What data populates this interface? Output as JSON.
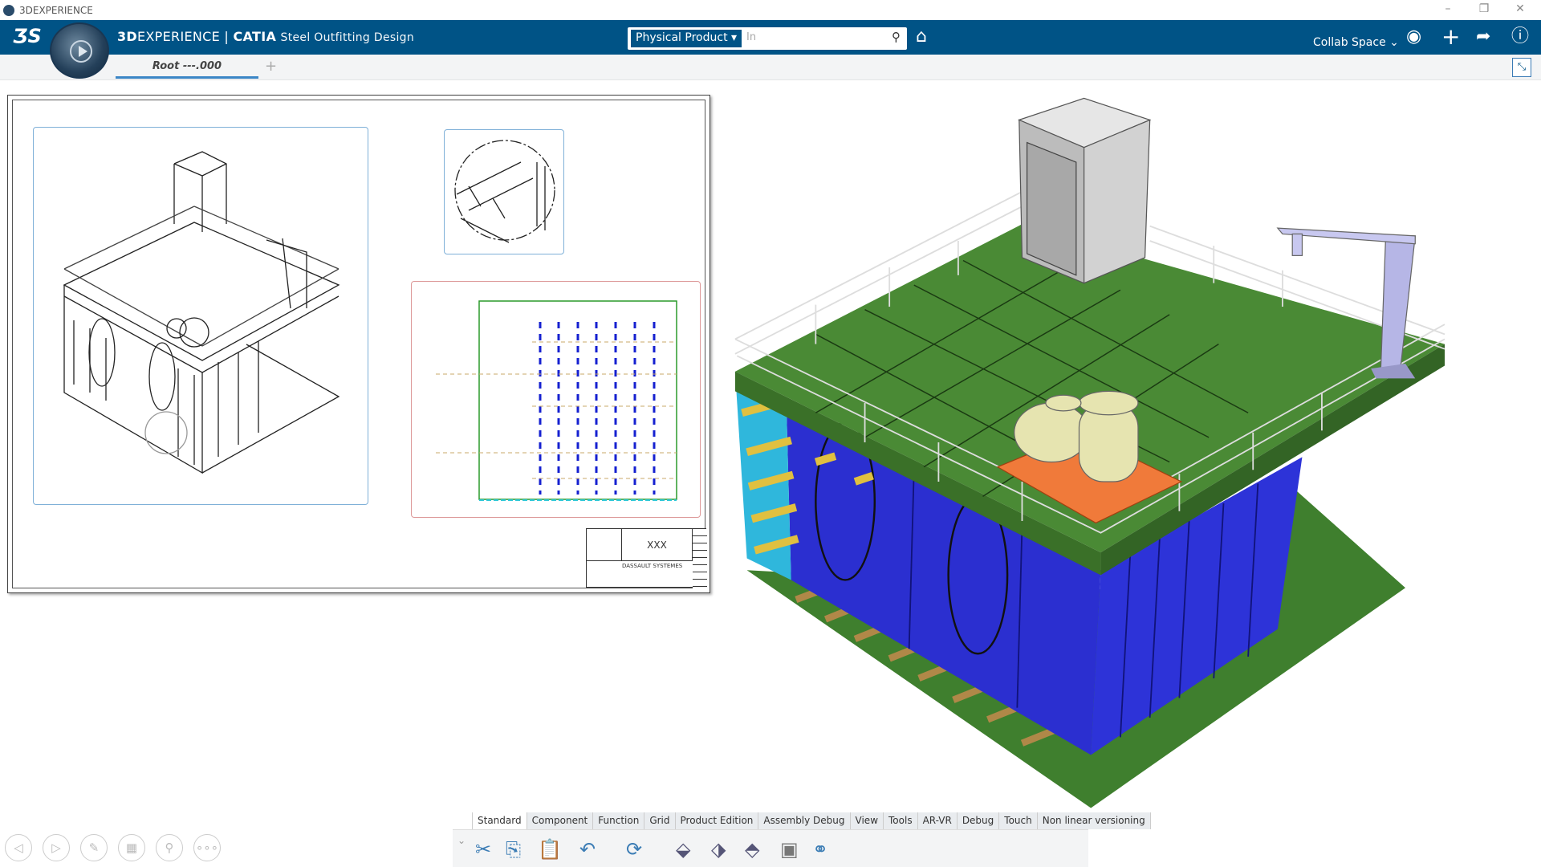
{
  "window": {
    "title": "3DEXPERIENCE",
    "minimize": "–",
    "restore": "❐",
    "close": "✕"
  },
  "header": {
    "brand_bold": "3D",
    "brand_rest": "EXPERIENCE | ",
    "brand_catia": "CATIA",
    "app_name": "Steel Outfitting Design",
    "search_scope": "Physical Product ▾",
    "search_placeholder": "In",
    "collab_space": "Collab Space ⌄",
    "color": "#005386"
  },
  "tabs": [
    {
      "label": "Root ---.000",
      "active": true
    }
  ],
  "add_tab": "+",
  "drawing": {
    "title_block_title": "XXX",
    "company": "DASSAULT SYSTEMES"
  },
  "toolbar": {
    "tabs": [
      "Standard",
      "Component",
      "Function",
      "Grid",
      "Product Edition",
      "Assembly Debug",
      "View",
      "Tools",
      "AR-VR",
      "Debug",
      "Touch",
      "Non linear versioning"
    ],
    "active_tab": "Standard",
    "icons": [
      "cut-icon",
      "copy-icon",
      "paste-icon",
      "undo-icon",
      "update-icon",
      "edit-component-icon",
      "replace-component-icon",
      "reorder-icon",
      "reuse-icon",
      "instantiate-icon"
    ]
  },
  "nav_buttons": [
    "back-icon",
    "forward-icon",
    "pen-icon",
    "layout-icon",
    "search-icon",
    "more-icon"
  ],
  "colors": {
    "deck": "#3f7f2e",
    "bulkhead": "#2b2fd0",
    "plate": "#2fb7dc",
    "pad": "#f07a3a",
    "tower": "#c8c8c8",
    "crane": "#b6b6e6"
  }
}
